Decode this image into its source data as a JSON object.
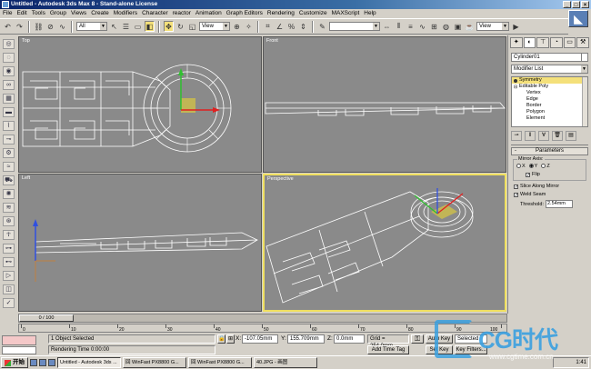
{
  "window": {
    "title": "Untitled - Autodesk 3ds Max 8 - Stand-alone License"
  },
  "menu": [
    "File",
    "Edit",
    "Tools",
    "Group",
    "Views",
    "Create",
    "Modifiers",
    "Character",
    "reactor",
    "Animation",
    "Graph Editors",
    "Rendering",
    "Customize",
    "MAXScript",
    "Help"
  ],
  "toolbar": {
    "selection_filter": "All",
    "ref_coord": "View",
    "ref_coord2": "View",
    "named_selection": ""
  },
  "viewports": {
    "top": "Top",
    "front": "Front",
    "left": "Left",
    "perspective": "Perspective"
  },
  "command_panel": {
    "object_name": "Cylinder01",
    "modifier_list": "Modifier List",
    "stack": [
      "Symmetry",
      "Editable Poly",
      "Vertex",
      "Edge",
      "Border",
      "Polygon",
      "Element"
    ],
    "rollout_title": "Parameters",
    "mirror_axis_label": "Mirror Axis:",
    "axes": [
      "X",
      "Y",
      "Z"
    ],
    "flip_label": "Flip",
    "slice_label": "Slice Along Mirror",
    "weld_label": "Weld Seam",
    "threshold_label": "Threshold:",
    "threshold_value": "2.54mm"
  },
  "timeline": {
    "position": "0 / 100",
    "ticks": [
      "0",
      "10",
      "20",
      "30",
      "40",
      "50",
      "60",
      "70",
      "80",
      "90",
      "100"
    ]
  },
  "status": {
    "selection": "1 Object Selected",
    "prompt": "Rendering Time  0:00:00",
    "x_label": "X:",
    "x_value": "-107.05mm",
    "y_label": "Y:",
    "y_value": "155.709mm",
    "z_label": "Z:",
    "z_value": "0.0mm",
    "grid": "Grid = 254.0mm",
    "add_time_tag": "Add Time Tag",
    "auto_key": "Auto Key",
    "set_key": "Set Key",
    "selected": "Selected",
    "key_filters": "Key Filters..."
  },
  "taskbar": {
    "start": "开始",
    "tasks": [
      "Untitled - Autodesk 3ds ...",
      "回 WinFast PX8800 G...",
      "回 WinFast PX8800 G...",
      "40.JPG - 画图"
    ],
    "clock": "1:41"
  },
  "watermark": {
    "brand": "CG时代",
    "url": "www.cgtime.com.cn"
  },
  "colors": {
    "accent_yellow": "#f4e07a",
    "viewport_gray": "#8a8a8a",
    "mesh_white": "#ffffff"
  }
}
